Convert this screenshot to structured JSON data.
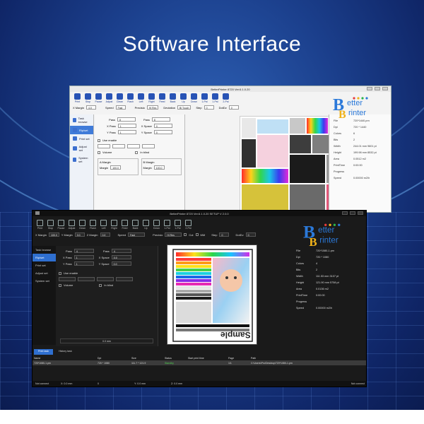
{
  "headline": "Software Interface",
  "logo": {
    "line1": "etter",
    "line2": "rinter"
  },
  "colors": {
    "accent": "#2f6fd0",
    "bg_deep": "#0f2566",
    "light_window": "#f3f3f3",
    "dark_window": "#1a1a1a"
  },
  "light_window": {
    "title": "BetterPrinter 8720 Ver:6.1.0.20",
    "toolbar": [
      {
        "label": "Print",
        "icon": "printer-icon"
      },
      {
        "label": "Stop",
        "icon": "stop-icon"
      },
      {
        "label": "Pause",
        "icon": "pause-icon"
      },
      {
        "label": "Adjust",
        "icon": "adjust-icon"
      },
      {
        "label": "Clean",
        "icon": "clean-icon"
      },
      {
        "label": "Flash",
        "icon": "flash-icon"
      },
      {
        "label": "Left",
        "icon": "arrow-left-icon"
      },
      {
        "label": "Right",
        "icon": "arrow-right-icon"
      },
      {
        "label": "Feed",
        "icon": "feed-icon"
      },
      {
        "label": "Back",
        "icon": "back-icon"
      },
      {
        "label": "Up",
        "icon": "arrow-up-icon"
      },
      {
        "label": "Down",
        "icon": "arrow-down-icon"
      },
      {
        "label": "1-Pst",
        "icon": "home-icon"
      },
      {
        "label": "1-Pst",
        "icon": "home-icon"
      },
      {
        "label": "2-Pst",
        "icon": "home-icon"
      }
    ],
    "params": {
      "x_margin_label": "X Margin",
      "x_margin": "4.0",
      "speed_label": "Speed",
      "speed": "Fast",
      "precision_label": "Precisio",
      "precision": "Hi Res",
      "deviation_label": "Deviation",
      "deviation": "Bi Touch",
      "step_label": "Step",
      "step": "0",
      "dot_v_label": "DotDv",
      "dot_v": "0"
    },
    "sidebar": [
      "Task browse",
      "Rip/set",
      "Print set",
      "Adjust set",
      "System set"
    ],
    "form": {
      "pass_label": "Pass",
      "pass": "8",
      "pass2_label": "Pass",
      "pass2": "8",
      "xpass_label": "X Pass",
      "xpass": "1",
      "xspace_label": "X Space",
      "xspace": "0",
      "ypass_label": "Y Pass",
      "ypass": "1",
      "yspace_label": "Y Space",
      "yspace": "0",
      "use_enable": "Use enable",
      "volume": "Volume",
      "inblind": "In blind",
      "amargin": "A Margin",
      "bmargin": "B Margin",
      "margin_label": "Margin",
      "margin_a": "100.0",
      "margin_b": "100.0"
    },
    "info": [
      {
        "k": "File",
        "v": "720*1440.prn"
      },
      {
        "k": "Dpi",
        "v": "720 * 1440"
      },
      {
        "k": "Colors",
        "v": "6"
      },
      {
        "k": "Bits",
        "v": "2"
      },
      {
        "k": "Width",
        "v": "244.01 mm  9601 pt"
      },
      {
        "k": "Height",
        "v": "199.98 mm  8532 pt"
      },
      {
        "k": "Area",
        "v": "0.0512 m2"
      },
      {
        "k": "PrintTime",
        "v": "0:00:00"
      },
      {
        "k": "Progress",
        "v": ""
      },
      {
        "k": "Speed",
        "v": "0.00000 m2/h"
      }
    ]
  },
  "dark_window": {
    "title": "BetterPrinter 8720 Ver:6.1.0.20 SETUP V 2.0.0",
    "toolbar": [
      {
        "label": "Print",
        "icon": "printer-icon"
      },
      {
        "label": "Stop",
        "icon": "stop-icon"
      },
      {
        "label": "Pause",
        "icon": "pause-icon"
      },
      {
        "label": "Adjust",
        "icon": "adjust-icon"
      },
      {
        "label": "Clean",
        "icon": "clean-icon"
      },
      {
        "label": "Flash",
        "icon": "flash-icon"
      },
      {
        "label": "Left",
        "icon": "arrow-left-icon"
      },
      {
        "label": "Right",
        "icon": "arrow-right-icon"
      },
      {
        "label": "Feed",
        "icon": "feed-icon"
      },
      {
        "label": "Back",
        "icon": "back-icon"
      },
      {
        "label": "Up",
        "icon": "arrow-up-icon"
      },
      {
        "label": "Down",
        "icon": "arrow-down-icon"
      },
      {
        "label": "1-Pst",
        "icon": "home-icon"
      },
      {
        "label": "1-Pst",
        "icon": "home-icon"
      },
      {
        "label": "2-Pst",
        "icon": "home-icon"
      }
    ],
    "params": {
      "x_margin_label": "X Margin",
      "x_margin": "100.0",
      "y_margin_label": "Y Margin",
      "y_margin": "0.0",
      "z_margin_label": "Z Margin",
      "z_margin": "0.0",
      "speed_label": "Speed",
      "speed": "Fast",
      "precision_label": "Precisio",
      "precision": "Hi Res",
      "cut_label": "Cut",
      "mm_label": "MM",
      "step_label": "Step",
      "step": "0",
      "dot_v_label": "DotDv",
      "dot_v": "0"
    },
    "sidebar": [
      "Task browse",
      "Rip/set",
      "Print set",
      "Adjust set",
      "System set"
    ],
    "form": {
      "pass_label": "Pass",
      "pass": "4",
      "pass2_label": "Pass",
      "pass2": "4",
      "xpass_label": "X Pass",
      "xpass": "1",
      "xspace_label": "X Space",
      "xspace": "0.0",
      "ypass_label": "Y Pass",
      "ypass": "1",
      "yspace_label": "Y Space",
      "yspace": "0.0",
      "use_enable": "Use enable",
      "volume": "Volume",
      "inblind": "In blind",
      "unit": "0.0 mm"
    },
    "info": [
      {
        "k": "File",
        "v": "720*1080-1.prn"
      },
      {
        "k": "Dpi",
        "v": "720 * 1080"
      },
      {
        "k": "Colors",
        "v": "4"
      },
      {
        "k": "Bits",
        "v": "2"
      },
      {
        "k": "Width",
        "v": "111.53 mm  3107 pt"
      },
      {
        "k": "Height",
        "v": "121.90 mm  5758 pt"
      },
      {
        "k": "Area",
        "v": "0.0136 m2"
      },
      {
        "k": "PrintTime",
        "v": "0:00:00"
      },
      {
        "k": "Progress",
        "v": ""
      },
      {
        "k": "Speed",
        "v": "0.00000 m2/h"
      }
    ],
    "preview_text": "Sample",
    "tabs": [
      "Print task",
      "History task"
    ],
    "table": {
      "headers": [
        "Name",
        "Dpi",
        "Size",
        "Status",
        "Start print time",
        "Page",
        "Path"
      ],
      "rows": [
        [
          "720*1080-1.prn",
          "720 * 1080",
          "111.7 * 121.9",
          "Standby",
          "",
          "1/1",
          "C:\\Users\\Pro\\Desktop\\720*1080-1.prn"
        ]
      ]
    },
    "status": {
      "left": "Not connect",
      "a": "X: 0.0 mm",
      "b": "0",
      "c": "Y: 0.0 mm",
      "d": "Z: 0.0 mm",
      "right": "Not connect"
    }
  }
}
